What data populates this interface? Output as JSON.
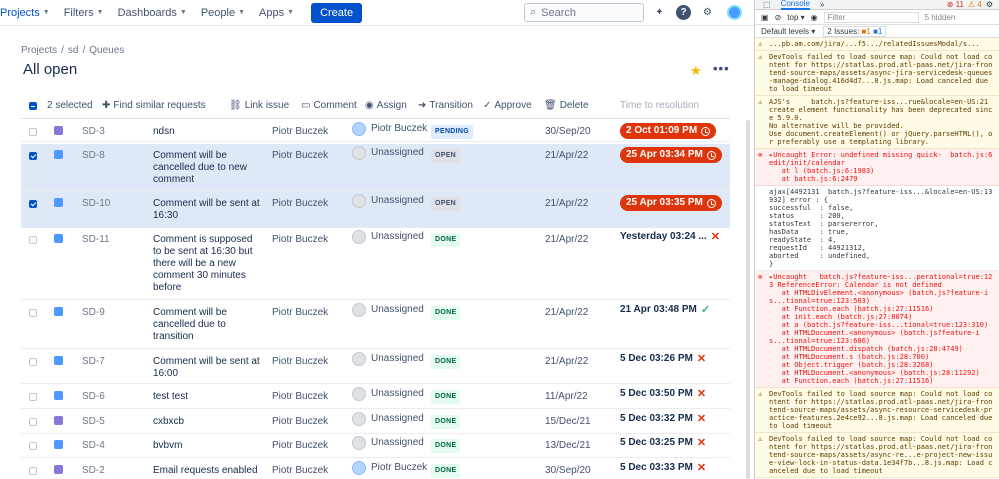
{
  "nav": {
    "items": [
      "Projects",
      "Filters",
      "Dashboards",
      "People",
      "Apps"
    ],
    "create_label": "Create",
    "search_placeholder": "Search"
  },
  "breadcrumb": [
    "Projects",
    "sd",
    "Queues"
  ],
  "page_title": "All open",
  "actions": {
    "selected": "2 selected",
    "find_similar": "Find similar requests",
    "link_issue": "Link issue",
    "comment": "Comment",
    "assign": "Assign",
    "transition": "Transition",
    "approve": "Approve",
    "delete": "Delete",
    "time_col": "Time to resolution"
  },
  "rows": [
    {
      "key": "SD-3",
      "summary": "ndsn",
      "reporter": "Piotr Buczek",
      "assignee": "Piotr Buczek",
      "status": "PENDING",
      "created": "30/Sep/20",
      "ttr": "2 Oct 01:09 PM",
      "ttr_style": "red",
      "selected": false,
      "type": "purple"
    },
    {
      "key": "SD-8",
      "summary": "Comment will be cancelled due to new comment",
      "reporter": "Piotr Buczek",
      "assignee": "Unassigned",
      "status": "OPEN",
      "created": "21/Apr/22",
      "ttr": "25 Apr 03:34 PM",
      "ttr_style": "red",
      "selected": true,
      "type": "blue"
    },
    {
      "key": "SD-10",
      "summary": "Comment will be sent at 16:30",
      "reporter": "Piotr Buczek",
      "assignee": "Unassigned",
      "status": "OPEN",
      "created": "21/Apr/22",
      "ttr": "25 Apr 03:35 PM",
      "ttr_style": "red",
      "selected": true,
      "type": "blue"
    },
    {
      "key": "SD-11",
      "summary": "Comment is supposed to be sent at 16:30 but there will be a new comment 30 minutes before",
      "reporter": "Piotr Buczek",
      "assignee": "Unassigned",
      "status": "DONE",
      "created": "21/Apr/22",
      "ttr": "Yesterday 03:24 ...",
      "ttr_style": "x",
      "selected": false,
      "type": "blue"
    },
    {
      "key": "SD-9",
      "summary": "Comment will be cancelled due to transition",
      "reporter": "Piotr Buczek",
      "assignee": "Unassigned",
      "status": "DONE",
      "created": "21/Apr/22",
      "ttr": "21 Apr 03:48 PM",
      "ttr_style": "check",
      "selected": false,
      "type": "blue"
    },
    {
      "key": "SD-7",
      "summary": "Comment will be sent at 16:00",
      "reporter": "Piotr Buczek",
      "assignee": "Unassigned",
      "status": "DONE",
      "created": "21/Apr/22",
      "ttr": "5 Dec 03:26 PM",
      "ttr_style": "x",
      "selected": false,
      "type": "blue"
    },
    {
      "key": "SD-6",
      "summary": "test test",
      "reporter": "Piotr Buczek",
      "assignee": "Unassigned",
      "status": "DONE",
      "created": "11/Apr/22",
      "ttr": "5 Dec 03:50 PM",
      "ttr_style": "x",
      "selected": false,
      "type": "blue"
    },
    {
      "key": "SD-5",
      "summary": "cxbxcb",
      "reporter": "Piotr Buczek",
      "assignee": "Unassigned",
      "status": "DONE",
      "created": "15/Dec/21",
      "ttr": "5 Dec 03:32 PM",
      "ttr_style": "x",
      "selected": false,
      "type": "purple"
    },
    {
      "key": "SD-4",
      "summary": "bvbvm",
      "reporter": "Piotr Buczek",
      "assignee": "Unassigned",
      "status": "DONE",
      "created": "13/Dec/21",
      "ttr": "5 Dec 03:25 PM",
      "ttr_style": "x",
      "selected": false,
      "type": "blue"
    },
    {
      "key": "SD-2",
      "summary": "Email requests enabled",
      "reporter": "Piotr Buczek",
      "assignee": "Piotr Buczek",
      "status": "DONE",
      "created": "30/Sep/20",
      "ttr": "5 Dec 03:33 PM",
      "ttr_style": "x",
      "selected": false,
      "type": "purple"
    }
  ],
  "devtools": {
    "tab": "Console",
    "error_count": "11",
    "warn_count": "4",
    "context": "top",
    "filter_placeholder": "Filter",
    "hidden": "5 hidden",
    "levels": "Default levels",
    "issues": "2 Issues:",
    "issues_err": "1",
    "issues_info": "1",
    "logs": [
      {
        "kind": "warn",
        "text": "...pb.am.com/jira/...f5.../relatedIssuesModal/s..."
      },
      {
        "kind": "warn",
        "text": "DevTools failed to load source map: Could not load content for https://statlas.prod.atl-paas.net/jira-frontend-source-maps/assets/async-jira-servicedesk-queues-manage-dialog.416d4d7...8.js.map: Load canceled due to load timeout"
      },
      {
        "kind": "warn",
        "text": "AJS's     batch.js?feature-iss...rue&locale=en-US:21 create element functionality has been deprecated since 5.9.0.\nNo alternative will be provided.\nUse document.createElement() or jQuery.parseHTML(), or preferably use a templating library."
      },
      {
        "kind": "err",
        "text": "▸Uncaught Error: undefined missing quick-  batch.js:6 edit/init/calendar\n   at l (batch.js:6:1983)\n   at batch.js:6:2479"
      },
      {
        "kind": "info",
        "text": "ajax[4492131  batch.js?feature-iss...&locale=en-US:13932] error : {\nsuccessful  : false,\nstatus      : 200,\nstatusText  : parsererror,\nhasData     : true,\nreadyState  : 4,\nrequestId   : 44921312,\naborted     : undefined,\n}"
      },
      {
        "kind": "err",
        "text": "▸Uncaught   batch.js?feature-iss...perational=true:123 ReferenceError: Calendar is not defined\n   at HTMLDivElement.<anonymous> (batch.js?feature-is...tional=true:123:503)\n   at Function.each (batch.js:27:11516)\n   at init.each (batch.js:27:8074)\n   at a (batch.js?feature-iss...tional=true:123:310)\n   at HTMLDocument.<anonymous> (batch.js?feature-is...tional=true:123:686)\n   at HTMLDocument.dispatch (batch.js:28:4749)\n   at HTMLDocument.s (batch.js:28:700)\n   at Object.trigger (batch.js:28:3268)\n   at HTMLDocument.<anonymous> (batch.js:28:11292)\n   at Function.each (batch.js:27:11516)"
      },
      {
        "kind": "warn",
        "text": "DevTools failed to load source map: Could not load content for https://statlas.prod.atl-paas.net/jira-frontend-source-maps/assets/async-resource-servicedesk-practice-features.2e4ce92...8.js.map: Load canceled due to load timeout"
      },
      {
        "kind": "warn",
        "text": "DevTools failed to load source map: Could not load content for https://statlas.prod.atl-paas.net/jira-frontend-source-maps/assets/async-re...e-project-new-issue-view-lock-in-status-data.1e34f7b...8.js.map: Load canceled due to load timeout"
      }
    ]
  }
}
